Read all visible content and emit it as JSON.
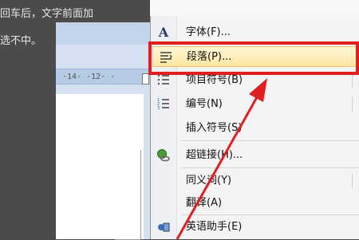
{
  "background": {
    "line1": "回车后，文字前面加",
    "line2": "选不中。"
  },
  "ruler": {
    "text": "·14· ·12· ·"
  },
  "context_menu": {
    "items": [
      {
        "label": "字体(F)...",
        "icon": "font-A-icon"
      },
      {
        "label": "段落(P)...",
        "icon": "paragraph-icon",
        "highlighted": true
      },
      {
        "label": "项目符号(B)",
        "icon": "bullets-icon"
      },
      {
        "label": "编号(N)",
        "icon": "numbering-icon"
      },
      {
        "label": "插入符号(S)",
        "icon": ""
      },
      {
        "label": "超链接(H)...",
        "icon": "hyperlink-icon"
      },
      {
        "label": "同义词(Y)",
        "icon": ""
      },
      {
        "label": "翻译(A)",
        "icon": ""
      },
      {
        "label": "英语助手(E)",
        "icon": "english-assistant-icon"
      }
    ]
  },
  "colors": {
    "highlight_border": "#e02020",
    "arrow": "#e02020"
  }
}
